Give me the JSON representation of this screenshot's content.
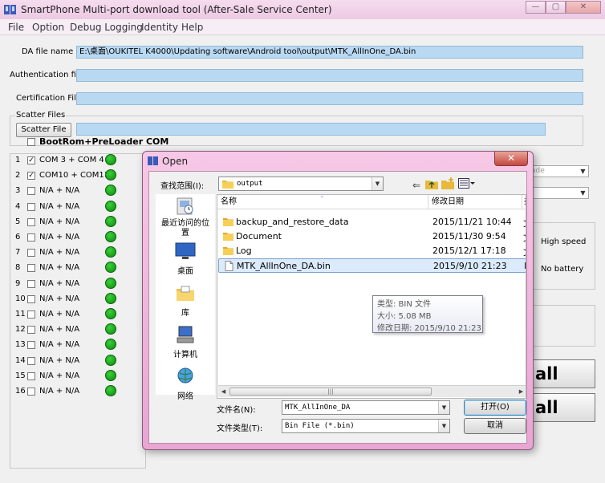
{
  "window": {
    "title": "SmartPhone Multi-port download tool (After-Sale Service Center)",
    "controls": {
      "minimize": "—",
      "maximize": "▢",
      "close": "✕"
    }
  },
  "menu": [
    "File",
    "Option",
    "Debug Logging",
    "Identity",
    "Help"
  ],
  "form": {
    "da_label": "DA file name",
    "da_value": "E:\\桌面\\OUKITEL K4000\\Updating software\\Android tool\\output\\MTK_AllInOne_DA.bin",
    "auth_label": "Authentication file",
    "auth_value": "",
    "cert_label": "Certification File",
    "cert_value": "",
    "scatter_group": "Scatter Files",
    "scatter_button": "Scatter File",
    "scatter_value": ""
  },
  "ports": {
    "header": "BootRom+PreLoader COM",
    "rows": [
      {
        "num": "1",
        "checked": true,
        "name": "COM 3 + COM 4"
      },
      {
        "num": "2",
        "checked": true,
        "name": "COM10 + COM11"
      },
      {
        "num": "3",
        "checked": false,
        "name": "N/A + N/A"
      },
      {
        "num": "4",
        "checked": false,
        "name": "N/A + N/A"
      },
      {
        "num": "5",
        "checked": false,
        "name": "N/A + N/A"
      },
      {
        "num": "6",
        "checked": false,
        "name": "N/A + N/A"
      },
      {
        "num": "7",
        "checked": false,
        "name": "N/A + N/A"
      },
      {
        "num": "8",
        "checked": false,
        "name": "N/A + N/A"
      },
      {
        "num": "9",
        "checked": false,
        "name": "N/A + N/A"
      },
      {
        "num": "10",
        "checked": false,
        "name": "N/A + N/A"
      },
      {
        "num": "11",
        "checked": false,
        "name": "N/A + N/A"
      },
      {
        "num": "12",
        "checked": false,
        "name": "N/A + N/A"
      },
      {
        "num": "13",
        "checked": false,
        "name": "N/A + N/A"
      },
      {
        "num": "14",
        "checked": false,
        "name": "N/A + N/A"
      },
      {
        "num": "15",
        "checked": false,
        "name": "N/A + N/A"
      },
      {
        "num": "16",
        "checked": false,
        "name": "N/A + N/A"
      }
    ]
  },
  "right": {
    "combo1_partial": "ade",
    "high_speed": "High speed",
    "no_battery": "No battery",
    "start_all_partial": "all",
    "stop_all_partial": "all"
  },
  "dialog": {
    "title": "Open",
    "close": "✕",
    "lookin_label": "查找范围(I):",
    "lookin_value": "output",
    "places": [
      "最近访问的位置",
      "桌面",
      "库",
      "计算机",
      "网络"
    ],
    "columns": {
      "name": "名称",
      "date": "修改日期",
      "more": "类"
    },
    "files": [
      {
        "name": "backup_and_restore_data",
        "date": "2015/11/21 10:44",
        "type": "folder",
        "extra": "文"
      },
      {
        "name": "Document",
        "date": "2015/11/30 9:54",
        "type": "folder",
        "extra": "文"
      },
      {
        "name": "Log",
        "date": "2015/12/1 17:18",
        "type": "folder",
        "extra": "文"
      },
      {
        "name": "MTK_AllInOne_DA.bin",
        "date": "2015/9/10 21:23",
        "type": "file",
        "extra": "B"
      }
    ],
    "tooltip": {
      "type": "类型: BIN 文件",
      "size": "大小: 5.08 MB",
      "modified": "修改日期: 2015/9/10 21:23"
    },
    "filename_label": "文件名(N):",
    "filename_value": "MTK_AllInOne_DA",
    "filetype_label": "文件类型(T):",
    "filetype_value": "Bin File (*.bin)",
    "open_button": "打开(O)",
    "cancel_button": "取消"
  },
  "colors": {
    "title_bar": "#ecc9e3",
    "field_fill": "#b9d9f3",
    "led_green": "#0a8a0a",
    "dialog_frame": "#e9a5d3",
    "selection": "#dcebfc"
  }
}
